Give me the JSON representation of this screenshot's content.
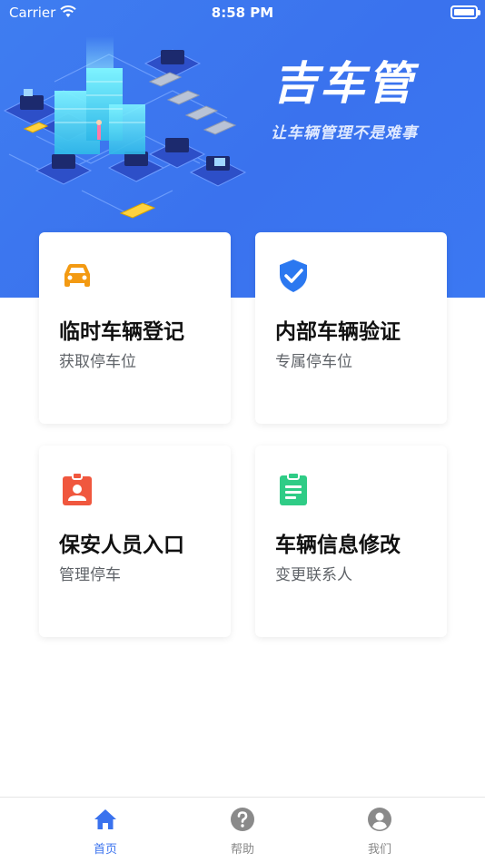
{
  "status_bar": {
    "carrier": "Carrier",
    "time": "8:58 PM"
  },
  "hero": {
    "title": "吉车管",
    "subtitle": "让车辆管理不是难事",
    "illustration": "isometric-smart-city-parking-illustration"
  },
  "colors": {
    "brand_blue": "#3a72ee",
    "car_icon": "#f39a12",
    "shield_icon": "#2b78f0",
    "badge_icon": "#f0573e",
    "clipboard_icon": "#2fcc86"
  },
  "cards": [
    {
      "title": "临时车辆登记",
      "subtitle": "获取停车位",
      "icon": "car-icon"
    },
    {
      "title": "内部车辆验证",
      "subtitle": "专属停车位",
      "icon": "shield-check-icon"
    },
    {
      "title": "保安人员入口",
      "subtitle": "管理停车",
      "icon": "id-badge-icon"
    },
    {
      "title": "车辆信息修改",
      "subtitle": "变更联系人",
      "icon": "clipboard-icon"
    }
  ],
  "tabs": [
    {
      "label": "首页",
      "icon": "home-icon",
      "active": true
    },
    {
      "label": "帮助",
      "icon": "help-icon",
      "active": false
    },
    {
      "label": "我们",
      "icon": "user-icon",
      "active": false
    }
  ]
}
